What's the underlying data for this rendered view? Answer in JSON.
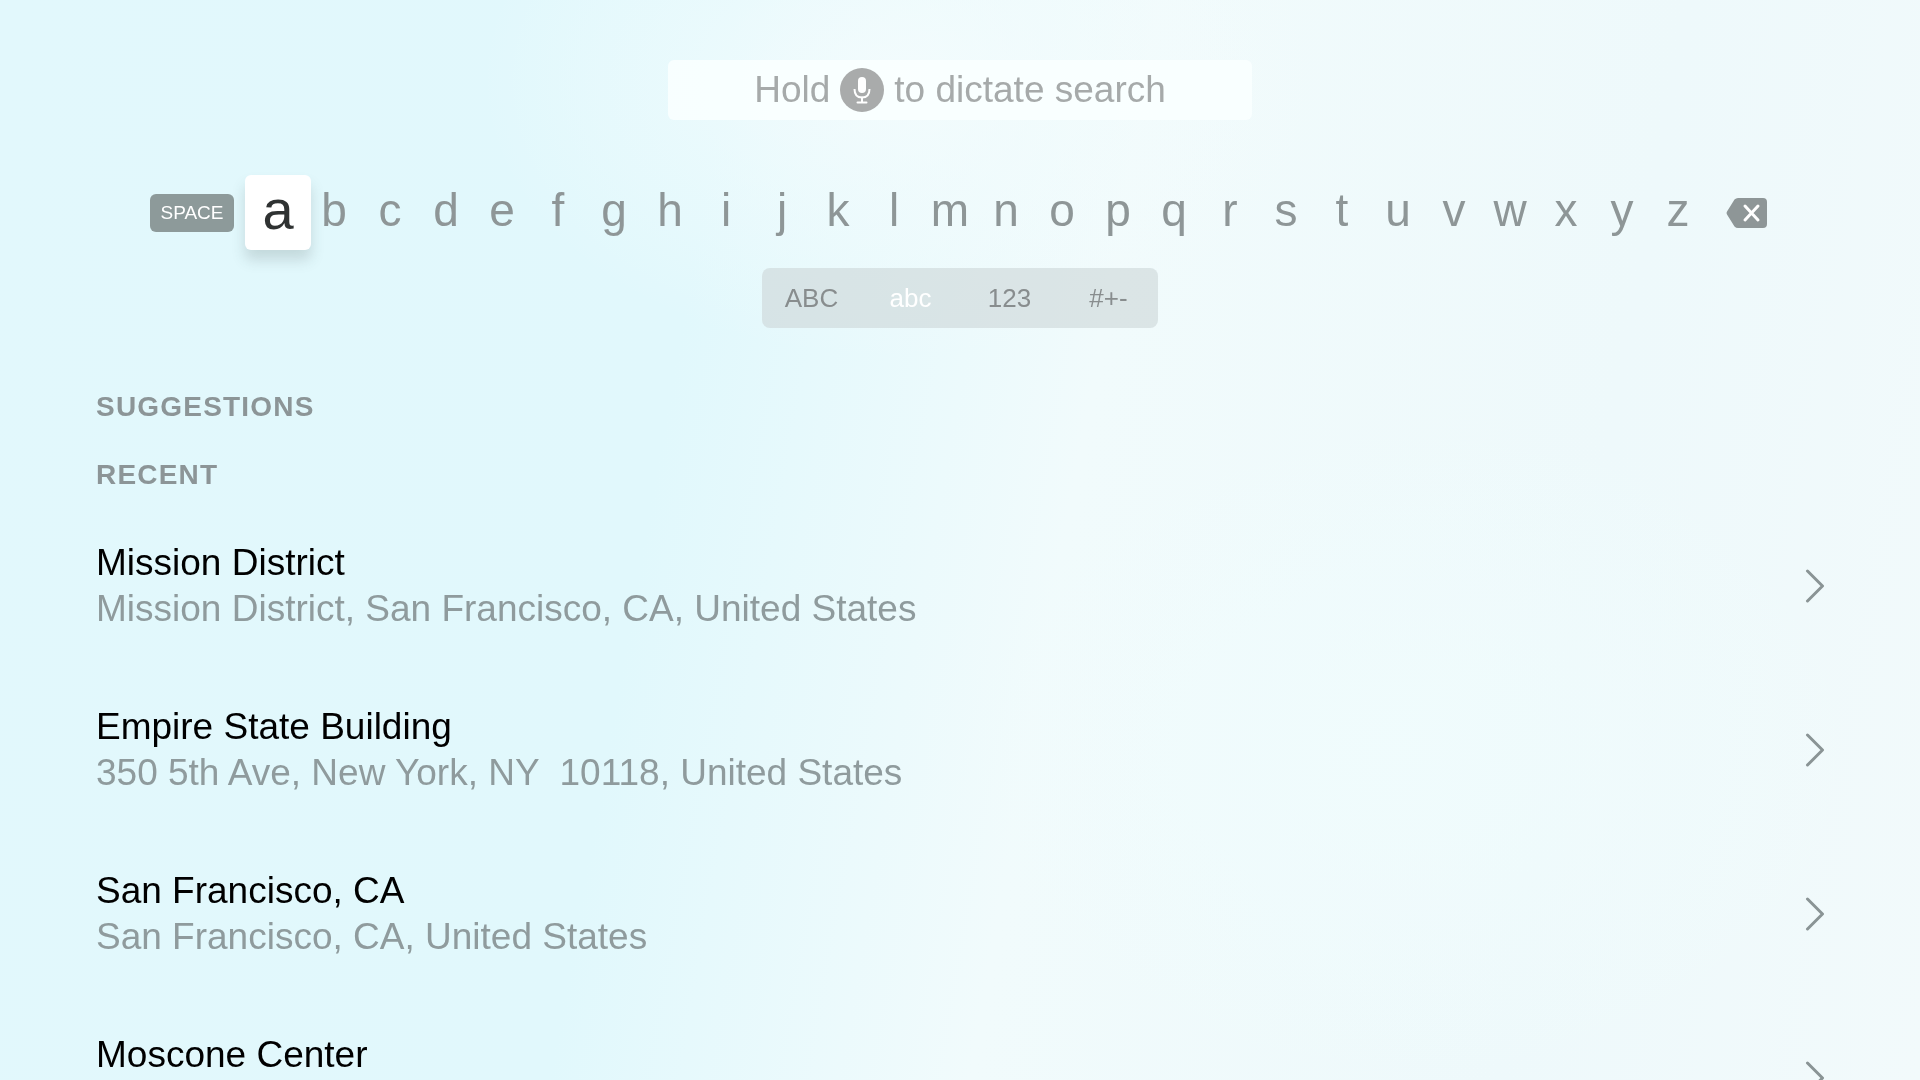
{
  "search_field": {
    "hint_start": "Hold",
    "hint_end": "to dictate search"
  },
  "keyboard": {
    "keys": [
      {
        "kind": "space",
        "label": "SPACE",
        "selected": false
      },
      {
        "kind": "letter",
        "label": "a",
        "selected": true
      },
      {
        "kind": "letter",
        "label": "b",
        "selected": false
      },
      {
        "kind": "letter",
        "label": "c",
        "selected": false
      },
      {
        "kind": "letter",
        "label": "d",
        "selected": false
      },
      {
        "kind": "letter",
        "label": "e",
        "selected": false
      },
      {
        "kind": "letter",
        "label": "f",
        "selected": false
      },
      {
        "kind": "letter",
        "label": "g",
        "selected": false
      },
      {
        "kind": "letter",
        "label": "h",
        "selected": false
      },
      {
        "kind": "letter",
        "label": "i",
        "selected": false
      },
      {
        "kind": "letter",
        "label": "j",
        "selected": false
      },
      {
        "kind": "letter",
        "label": "k",
        "selected": false
      },
      {
        "kind": "letter",
        "label": "l",
        "selected": false
      },
      {
        "kind": "letter",
        "label": "m",
        "selected": false
      },
      {
        "kind": "letter",
        "label": "n",
        "selected": false
      },
      {
        "kind": "letter",
        "label": "o",
        "selected": false
      },
      {
        "kind": "letter",
        "label": "p",
        "selected": false
      },
      {
        "kind": "letter",
        "label": "q",
        "selected": false
      },
      {
        "kind": "letter",
        "label": "r",
        "selected": false
      },
      {
        "kind": "letter",
        "label": "s",
        "selected": false
      },
      {
        "kind": "letter",
        "label": "t",
        "selected": false
      },
      {
        "kind": "letter",
        "label": "u",
        "selected": false
      },
      {
        "kind": "letter",
        "label": "v",
        "selected": false
      },
      {
        "kind": "letter",
        "label": "w",
        "selected": false
      },
      {
        "kind": "letter",
        "label": "x",
        "selected": false
      },
      {
        "kind": "letter",
        "label": "y",
        "selected": false
      },
      {
        "kind": "letter",
        "label": "z",
        "selected": false
      },
      {
        "kind": "delete",
        "selected": false
      }
    ],
    "modes": [
      {
        "label": "ABC",
        "selected": false
      },
      {
        "label": "abc",
        "selected": true
      },
      {
        "label": "123",
        "selected": false
      },
      {
        "label": "#+-",
        "selected": false
      }
    ]
  },
  "suggestions": {
    "heading": "SUGGESTIONS"
  },
  "recent": {
    "heading": "RECENT",
    "items": [
      {
        "title": "Mission District",
        "subtitle": "Mission District, San Francisco, CA, United States"
      },
      {
        "title": "Empire State Building",
        "subtitle": "350 5th Ave, New York, NY  10118, United States"
      },
      {
        "title": "San Francisco, CA",
        "subtitle": "San Francisco, CA, United States"
      },
      {
        "title": "Moscone Center"
      }
    ]
  }
}
